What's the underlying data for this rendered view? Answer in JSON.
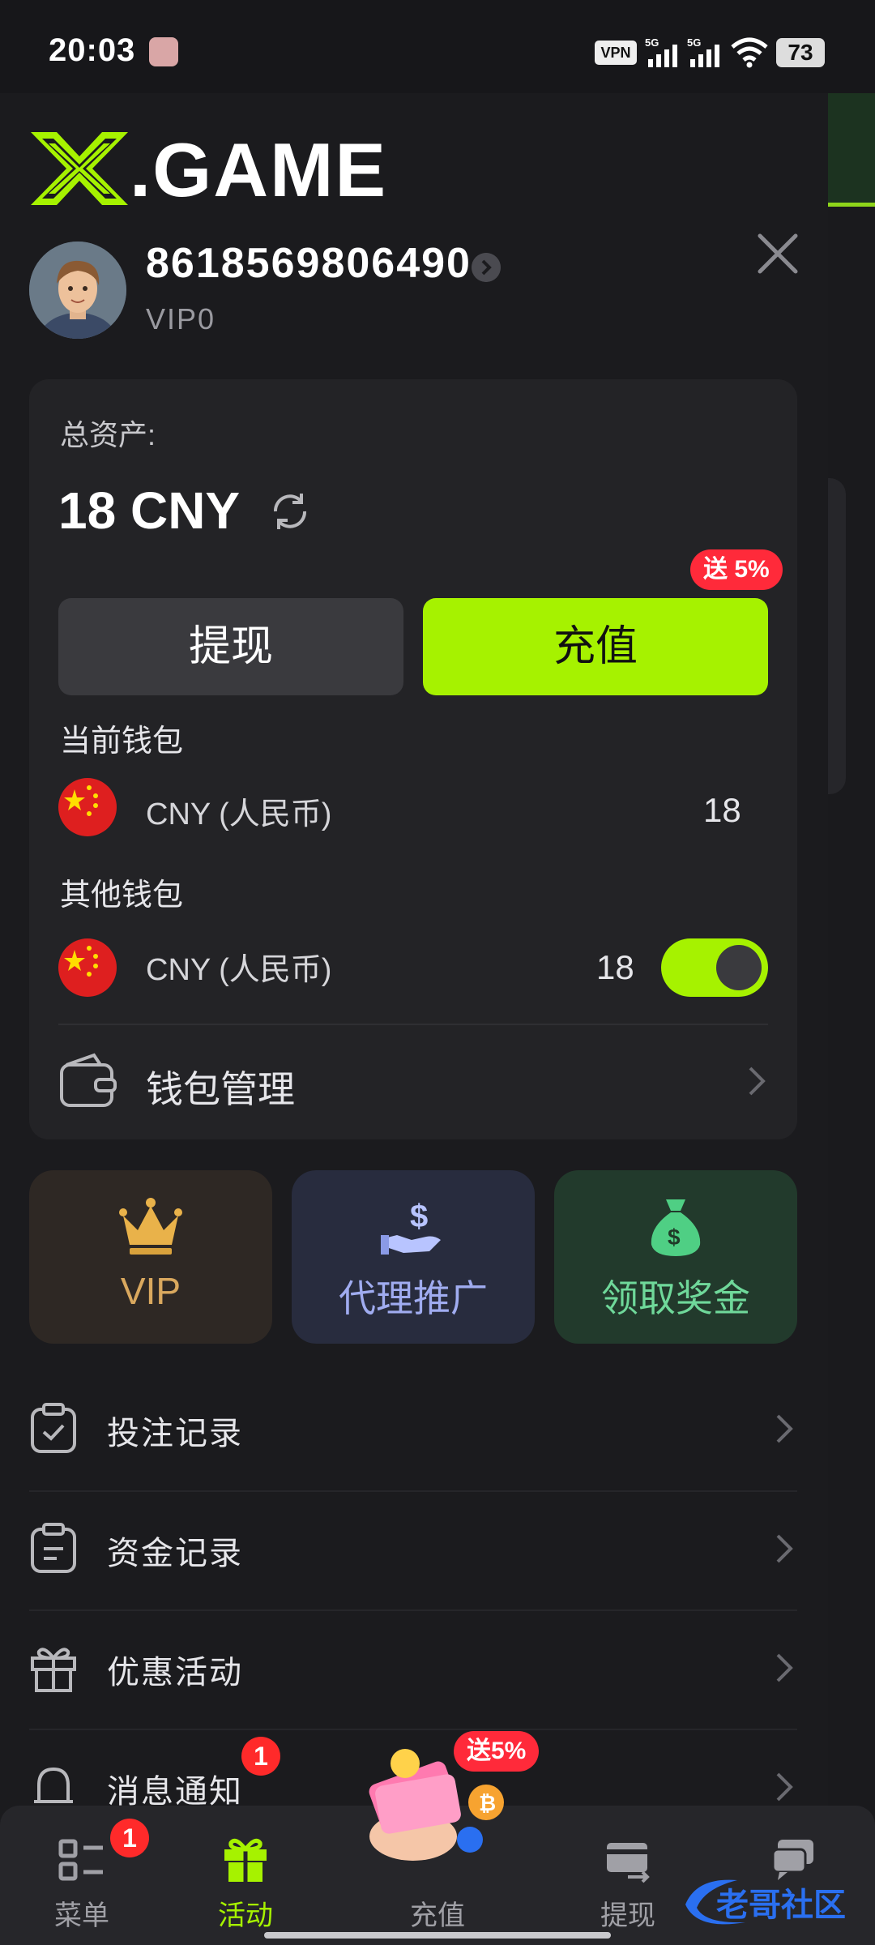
{
  "status_bar": {
    "time": "20:03",
    "vpn": "VPN",
    "sim1": "5G",
    "sim2": "5G",
    "battery": "73"
  },
  "brand": {
    "logo_mark": "X",
    "logo_text": ".GAME",
    "accent": "#a6f200"
  },
  "user": {
    "phone": "8618569806490",
    "vip": "VIP0"
  },
  "wallet": {
    "total_label": "总资产:",
    "total_value": "18 CNY",
    "withdraw_label": "提现",
    "deposit_label": "充值",
    "deposit_bonus": "送 5%",
    "current_label": "当前钱包",
    "current": {
      "currency": "CNY (人民币)",
      "amount": "18"
    },
    "other_label": "其他钱包",
    "other": {
      "currency": "CNY (人民币)",
      "amount": "18",
      "enabled": true
    },
    "manage_label": "钱包管理"
  },
  "tiles": [
    {
      "label": "VIP",
      "icon": "crown-icon"
    },
    {
      "label": "代理推广",
      "icon": "hand-dollar-icon"
    },
    {
      "label": "领取奖金",
      "icon": "money-bag-icon"
    }
  ],
  "menu": [
    {
      "label": "投注记录",
      "icon": "clipboard-check-icon"
    },
    {
      "label": "资金记录",
      "icon": "clipboard-list-icon"
    },
    {
      "label": "优惠活动",
      "icon": "gift-icon"
    },
    {
      "label": "消息通知",
      "icon": "bell-icon",
      "badge": "1"
    }
  ],
  "bottom_nav": {
    "items": [
      {
        "label": "菜单",
        "icon": "menu-grid-icon",
        "badge": "1"
      },
      {
        "label": "活动",
        "icon": "gift-icon",
        "active": true
      },
      {
        "label": "充值",
        "icon": "deposit-icon",
        "bonus": "送5%"
      },
      {
        "label": "提现",
        "icon": "card-transfer-icon"
      },
      {
        "label": "",
        "icon": "chat-icon"
      }
    ]
  },
  "watermark": {
    "text": "老哥社区"
  }
}
